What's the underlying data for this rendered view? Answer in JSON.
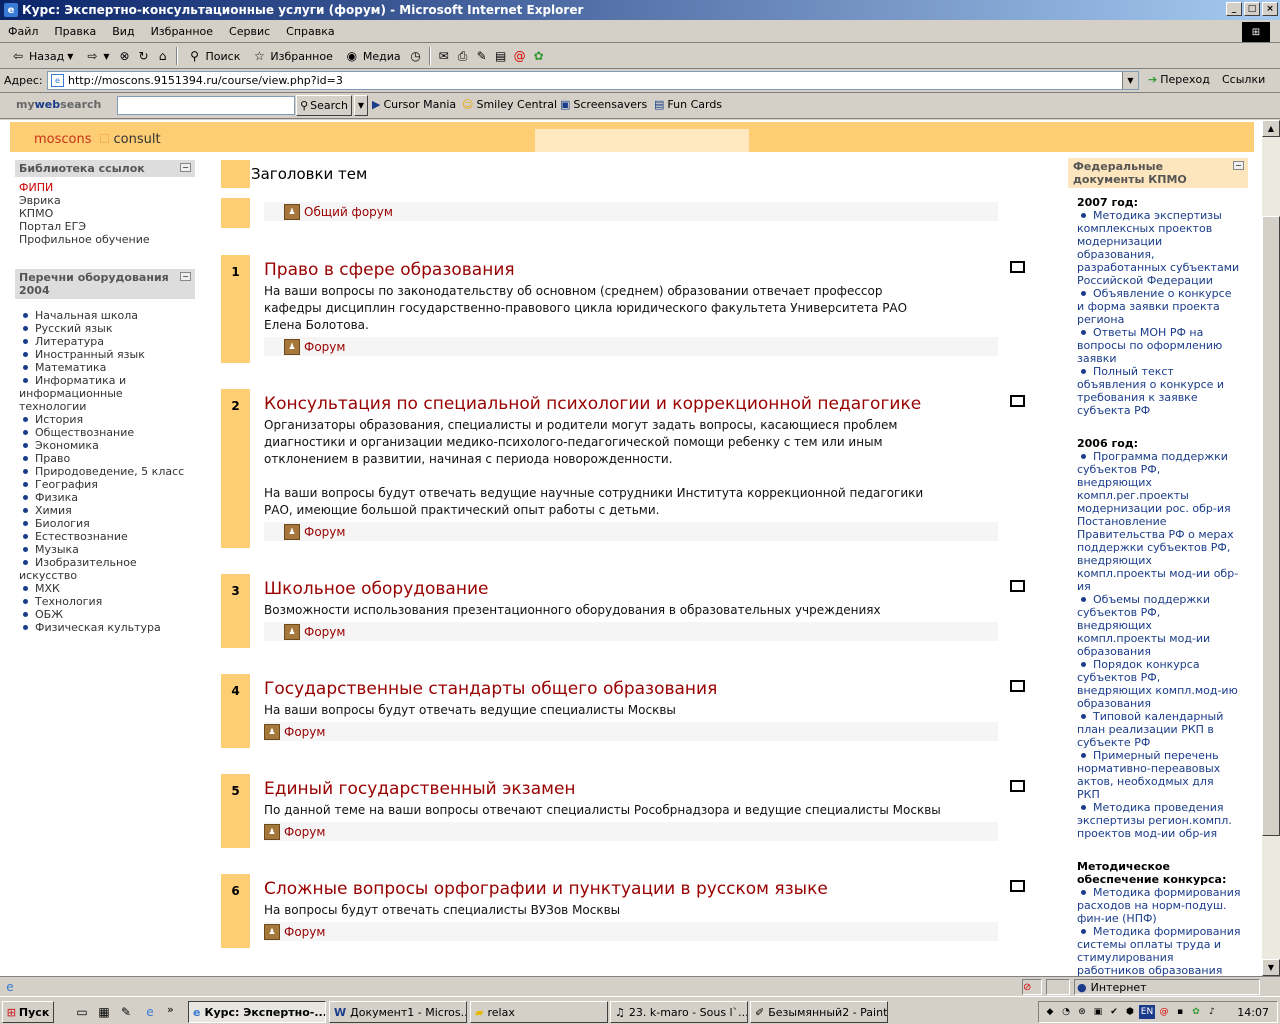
{
  "window": {
    "title": "Курс: Экспертно-консультационные услуги (форум) - Microsoft Internet Explorer",
    "min": "_",
    "max": "□",
    "close": "×"
  },
  "menu": [
    "Файл",
    "Правка",
    "Вид",
    "Избранное",
    "Сервис",
    "Справка"
  ],
  "toolbar": {
    "back": "Назад",
    "search": "Поиск",
    "favorites": "Избранное",
    "media": "Медиа"
  },
  "address": {
    "label": "Адрес:",
    "url": "http://moscons.9151394.ru/course/view.php?id=3",
    "go": "Переход",
    "links": "Ссылки"
  },
  "searchbar": {
    "brand_my": "my",
    "brand_web": "web",
    "brand_search": "search",
    "button": "Search",
    "links": [
      "Cursor Mania",
      "Smiley Central",
      "Screensavers",
      "Fun Cards"
    ]
  },
  "site": {
    "logo_part1": "moscons",
    "logo_part2": "consult"
  },
  "left_blocks": {
    "links_title": "Библиотека ссылок",
    "links": [
      "ФИПИ",
      "Эврика",
      "КПМО",
      "Портал ЕГЭ",
      "Профильное обучение"
    ],
    "equip_title_1": "Перечни оборудования",
    "equip_title_2": "2004",
    "equip": [
      "Начальная школа",
      "Русский язык",
      "Литература",
      "Иностранный язык",
      "Математика",
      "Информатика и",
      "информационные",
      "технологии",
      "История",
      "Обществознание",
      "Экономика",
      "Право",
      "Природоведение, 5 класс",
      "География",
      "Физика",
      "Химия",
      "Биология",
      "Естествознание",
      "Музыка",
      "Изобразительное",
      "искусство",
      "МХК",
      "Технология",
      "ОБЖ",
      "Физическая культура"
    ]
  },
  "main": {
    "topics_header": "Заголовки тем",
    "general_forum": "Общий форум",
    "forum_label": "Форум",
    "sections": [
      {
        "num": "1",
        "title": "Право в сфере образования",
        "desc": [
          "На ваши вопросы по законодательству об основном (среднем) образовании отвечает профессор",
          "кафедры дисциплин государственно-правового цикла юридического факультета Университета РАО",
          "Елена Болотова."
        ]
      },
      {
        "num": "2",
        "title": "Консультация по специальной психологии и коррекционной педагогике",
        "desc": [
          "Организаторы образования, специалисты и родители могут задать вопросы, касающиеся проблем",
          "диагностики и организации медико-психолого-педагогической помощи ребенку с тем или иным",
          "отклонением в развитии, начиная с периода новорожденности.",
          "",
          "На ваши вопросы будут отвечать ведущие научные сотрудники Института коррекционной педагогики",
          "РАО, имеющие большой практический опыт работы с детьми."
        ]
      },
      {
        "num": "3",
        "title": "Школьное оборудование",
        "desc": [
          "Возможности использования презентационного оборудования в образовательных учреждениях"
        ]
      },
      {
        "num": "4",
        "title": "Государственные стандарты общего образования",
        "desc": [
          "На ваши вопросы будут отвечать ведущие специалисты Москвы"
        ]
      },
      {
        "num": "5",
        "title": "Единый государственный экзамен",
        "desc": [
          "По данной теме на ваши вопросы отвечают специалисты Рособрнадзора и ведущие специалисты Москвы"
        ]
      },
      {
        "num": "6",
        "title": "Сложные вопросы орфографии и пунктуации в русском языке",
        "desc": [
          "На вопросы будут отвечать специалисты ВУЗов Москвы"
        ]
      }
    ]
  },
  "right_block": {
    "title_1": "Федеральные",
    "title_2": "документы КПМО",
    "y2007": "2007 год:",
    "items_2007": [
      [
        "Методика экспертизы",
        "комплексных проектов",
        "модернизации",
        "образования,",
        "разработанных субъектами",
        "Российской Федерации"
      ],
      [
        "Объявление о конкурсе",
        "и форма заявки проекта",
        "региона"
      ],
      [
        "Ответы МОН РФ на",
        "вопросы по оформлению",
        "заявки"
      ],
      [
        "Полный текст",
        "объявления о конкурсе и",
        "требования к заявке",
        "субъекта РФ"
      ]
    ],
    "y2006": "2006 год:",
    "items_2006": [
      [
        "Программа поддержки",
        "субъектов РФ,",
        "внедряющих",
        "компл.рег.проекты",
        "модернизации рос. обр-ия",
        "Постановление",
        "Правительства РФ о мерах",
        "поддержки субъектов РФ,",
        "внедряющих",
        "компл.проекты мод-ии обр-",
        "ия"
      ],
      [
        "Объемы поддержки",
        "субъектов РФ,",
        "внедряющих",
        "компл.проекты мод-ии",
        "образования"
      ],
      [
        "Порядок конкурса",
        "субъектов РФ,",
        "внедряющих компл.мод-ию",
        "образования"
      ],
      [
        "Типовой календарный",
        "план реализации РКП в",
        "субъекте РФ"
      ],
      [
        "Примерный перечень",
        "нормативно-переавовых",
        "актов, необходмых для",
        "РКП"
      ],
      [
        "Методика проведения",
        "экспертизы регион.компл.",
        "проектов мод-ии обр-ия"
      ]
    ],
    "method_1": "Методическое",
    "method_2": "обеспечение конкурса:",
    "items_method": [
      [
        "Методика формирования",
        "расходов на норм-подуш.",
        "фин-ие (НПФ)"
      ],
      [
        "Методика формирования",
        "системы оплаты труда и",
        "стимулирования",
        "работников образования"
      ]
    ]
  },
  "status": {
    "zone": "Интернет"
  },
  "taskbar": {
    "start": "Пуск",
    "tasks": [
      "Курс: Экспертно-...",
      "Документ1 - Micros...",
      "relax",
      "23. k-maro - Sous l`...",
      "Безымянный2 - Paint"
    ],
    "lang": "EN",
    "clock": "14:07"
  }
}
